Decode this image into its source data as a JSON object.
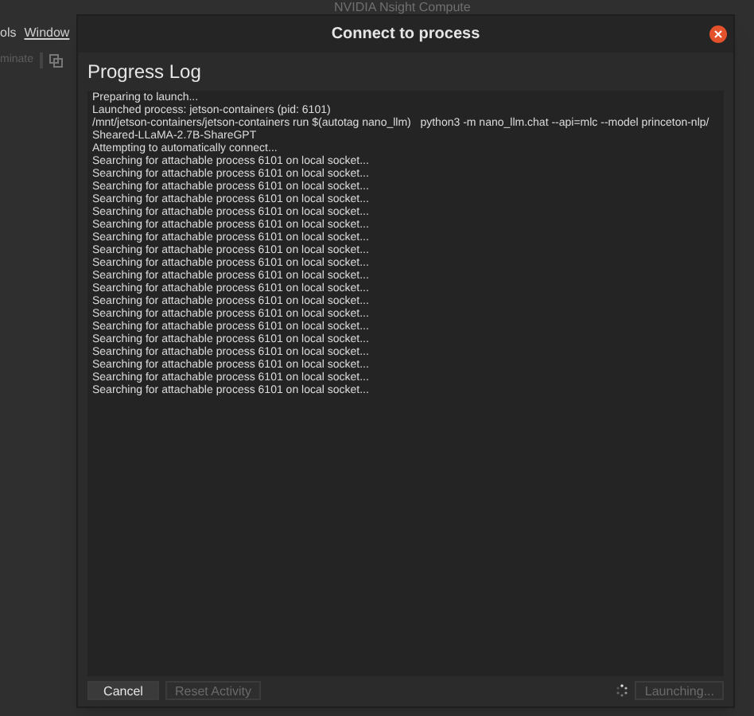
{
  "app": {
    "title": "NVIDIA Nsight Compute",
    "menu": [
      "ols",
      "Window"
    ],
    "toolbar_button": {
      "label": "minate",
      "disabled": true
    }
  },
  "dialog": {
    "title": "Connect to process",
    "heading": "Progress Log",
    "log": [
      "Preparing to launch...",
      "Launched process: jetson-containers (pid: 6101)",
      "/mnt/jetson-containers/jetson-containers run $(autotag nano_llm)   python3 -m nano_llm.chat --api=mlc --model princeton-nlp/",
      "Sheared-LLaMA-2.7B-ShareGPT",
      "Attempting to automatically connect...",
      "Searching for attachable process 6101 on local socket...",
      "Searching for attachable process 6101 on local socket...",
      "Searching for attachable process 6101 on local socket...",
      "Searching for attachable process 6101 on local socket...",
      "Searching for attachable process 6101 on local socket...",
      "Searching for attachable process 6101 on local socket...",
      "Searching for attachable process 6101 on local socket...",
      "Searching for attachable process 6101 on local socket...",
      "Searching for attachable process 6101 on local socket...",
      "Searching for attachable process 6101 on local socket...",
      "Searching for attachable process 6101 on local socket...",
      "Searching for attachable process 6101 on local socket...",
      "Searching for attachable process 6101 on local socket...",
      "Searching for attachable process 6101 on local socket...",
      "Searching for attachable process 6101 on local socket...",
      "Searching for attachable process 6101 on local socket...",
      "Searching for attachable process 6101 on local socket...",
      "Searching for attachable process 6101 on local socket...",
      "Searching for attachable process 6101 on local socket..."
    ],
    "buttons": [
      {
        "label": "Cancel",
        "disabled": false
      },
      {
        "label": "Reset Activity",
        "disabled": true
      }
    ],
    "launch_button": {
      "label": "Launching...",
      "disabled": true
    }
  }
}
